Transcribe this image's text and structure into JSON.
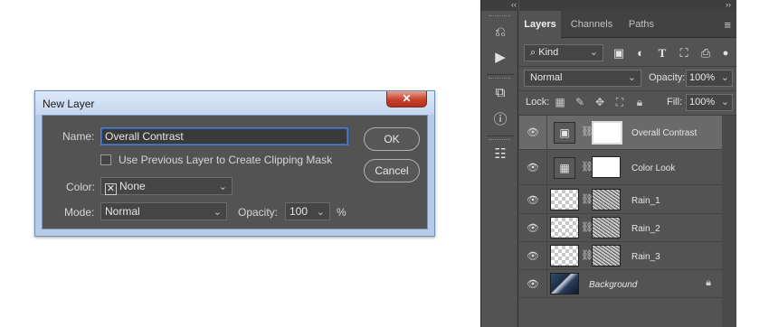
{
  "dialog": {
    "title": "New Layer",
    "close_symbol": "✕",
    "name_label": "Name:",
    "name_value": "Overall Contrast",
    "clip_label": "Use Previous Layer to Create Clipping Mask",
    "color_label": "Color:",
    "color_value": "None",
    "mode_label": "Mode:",
    "mode_value": "Normal",
    "opacity_label": "Opacity:",
    "opacity_value": "100",
    "opacity_unit": "%",
    "ok_label": "OK",
    "cancel_label": "Cancel"
  },
  "toolstrip": {
    "collapse_symbol": "‹‹",
    "icons": [
      "history-icon",
      "play-actions-icon",
      "3d-cube-icon",
      "info-icon",
      "properties-icon"
    ]
  },
  "panel": {
    "expand_symbol": "››",
    "tabs": [
      {
        "label": "Layers",
        "active": true
      },
      {
        "label": "Channels",
        "active": false
      },
      {
        "label": "Paths",
        "active": false
      }
    ],
    "filter_label": "Kind",
    "blend_mode": "Normal",
    "opacity_label": "Opacity:",
    "opacity_value": "100%",
    "lock_label": "Lock:",
    "fill_label": "Fill:",
    "fill_value": "100%",
    "layers": [
      {
        "name": "Overall Contrast",
        "selected": true,
        "italic": false
      },
      {
        "name": "Color Look",
        "selected": false,
        "italic": false
      },
      {
        "name": "Rain_1",
        "selected": false,
        "italic": false
      },
      {
        "name": "Rain_2",
        "selected": false,
        "italic": false
      },
      {
        "name": "Rain_3",
        "selected": false,
        "italic": false
      },
      {
        "name": "Background",
        "selected": false,
        "italic": true,
        "locked": true
      }
    ]
  },
  "colors": {
    "panel_bg": "#535353",
    "selected_layer": "#6a6a6a",
    "focus_ring": "#4f7fd1",
    "close_button": "#c7402a"
  }
}
